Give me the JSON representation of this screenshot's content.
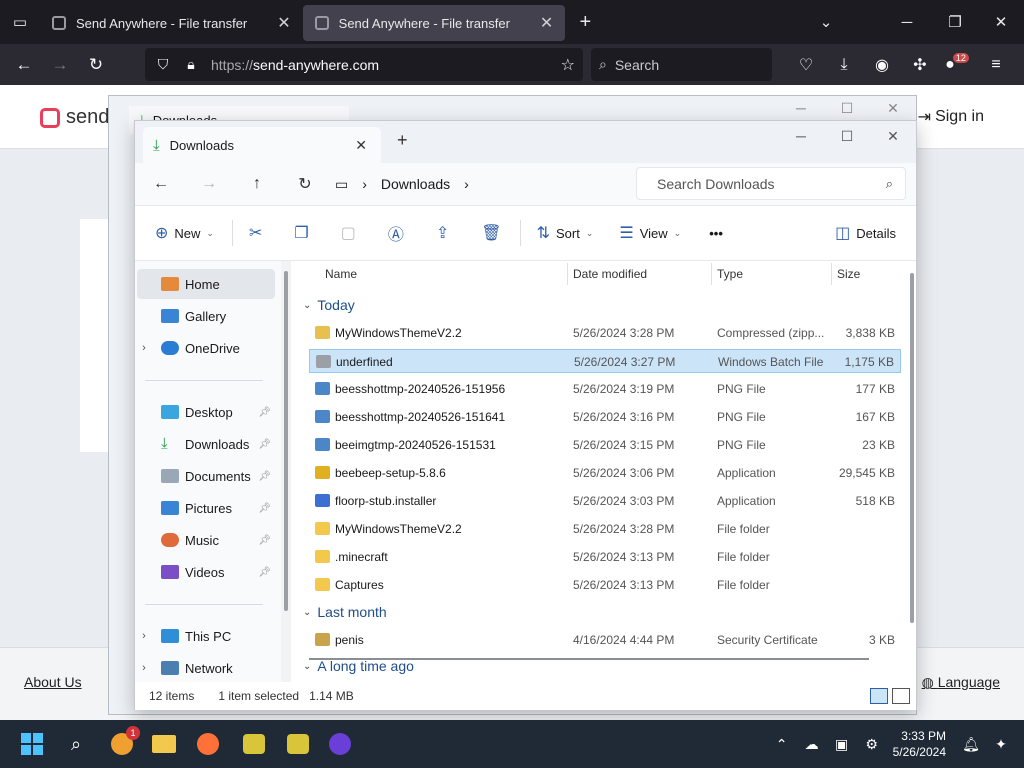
{
  "browser": {
    "tabs": [
      {
        "label": "Send Anywhere - File transfer"
      },
      {
        "label": "Send Anywhere - File transfer"
      }
    ],
    "url_protocol": "https://",
    "url_host": "send-anywhere.com",
    "search_placeholder": "Search",
    "extensions_badge": "12"
  },
  "webpage": {
    "logo_text": "senda",
    "sign_in": "Sign in",
    "footer_about": "About Us",
    "footer_language": "Language"
  },
  "ghost_window": {
    "tab_label": "Downloads"
  },
  "explorer": {
    "tab_label": "Downloads",
    "breadcrumb": "Downloads",
    "search_placeholder": "Search Downloads",
    "toolbar": {
      "new_label": "New",
      "sort_label": "Sort",
      "view_label": "View",
      "more_label": "•••",
      "details_label": "Details"
    },
    "nav": {
      "home": "Home",
      "gallery": "Gallery",
      "onedrive": "OneDrive",
      "desktop": "Desktop",
      "downloads": "Downloads",
      "documents": "Documents",
      "pictures": "Pictures",
      "music": "Music",
      "videos": "Videos",
      "this_pc": "This PC",
      "network": "Network"
    },
    "columns": {
      "name": "Name",
      "date": "Date modified",
      "type": "Type",
      "size": "Size"
    },
    "groups": {
      "today": "Today",
      "last_month": "Last month",
      "long_ago": "A long time ago"
    },
    "files": [
      {
        "name": "MyWindowsThemeV2.2",
        "date": "5/26/2024 3:28 PM",
        "type": "Compressed (zipp...",
        "size": "3,838 KB",
        "icon": "zip-folder-icon",
        "color": "#e8c04f"
      },
      {
        "name": "underfined",
        "date": "5/26/2024 3:27 PM",
        "type": "Windows Batch File",
        "size": "1,175 KB",
        "icon": "batch-file-icon",
        "color": "#9aa0a6"
      },
      {
        "name": "beesshottmp-20240526-151956",
        "date": "5/26/2024 3:19 PM",
        "type": "PNG File",
        "size": "177 KB",
        "icon": "png-file-icon",
        "color": "#4a86c8"
      },
      {
        "name": "beesshottmp-20240526-151641",
        "date": "5/26/2024 3:16 PM",
        "type": "PNG File",
        "size": "167 KB",
        "icon": "png-file-icon",
        "color": "#4a86c8"
      },
      {
        "name": "beeimgtmp-20240526-151531",
        "date": "5/26/2024 3:15 PM",
        "type": "PNG File",
        "size": "23 KB",
        "icon": "png-file-icon",
        "color": "#4a86c8"
      },
      {
        "name": "beebeep-setup-5.8.6",
        "date": "5/26/2024 3:06 PM",
        "type": "Application",
        "size": "29,545 KB",
        "icon": "bee-app-icon",
        "color": "#e0b020"
      },
      {
        "name": "floorp-stub.installer",
        "date": "5/26/2024 3:03 PM",
        "type": "Application",
        "size": "518 KB",
        "icon": "floorp-app-icon",
        "color": "#3b6fd4"
      },
      {
        "name": "MyWindowsThemeV2.2",
        "date": "5/26/2024 3:28 PM",
        "type": "File folder",
        "size": "",
        "icon": "folder-icon",
        "color": "#f2c94c"
      },
      {
        "name": ".minecraft",
        "date": "5/26/2024 3:13 PM",
        "type": "File folder",
        "size": "",
        "icon": "folder-icon",
        "color": "#f2c94c"
      },
      {
        "name": "Captures",
        "date": "5/26/2024 3:13 PM",
        "type": "File folder",
        "size": "",
        "icon": "folder-icon",
        "color": "#f2c94c"
      }
    ],
    "last_month_files": [
      {
        "name": "penis",
        "date": "4/16/2024 4:44 PM",
        "type": "Security Certificate",
        "size": "3 KB",
        "icon": "certificate-icon",
        "color": "#c9a44a"
      }
    ],
    "status": {
      "items": "12 items",
      "selected": "1 item selected",
      "size": "1.14 MB"
    }
  },
  "taskbar": {
    "notification_badge": "1",
    "time": "3:33 PM",
    "date": "5/26/2024"
  }
}
